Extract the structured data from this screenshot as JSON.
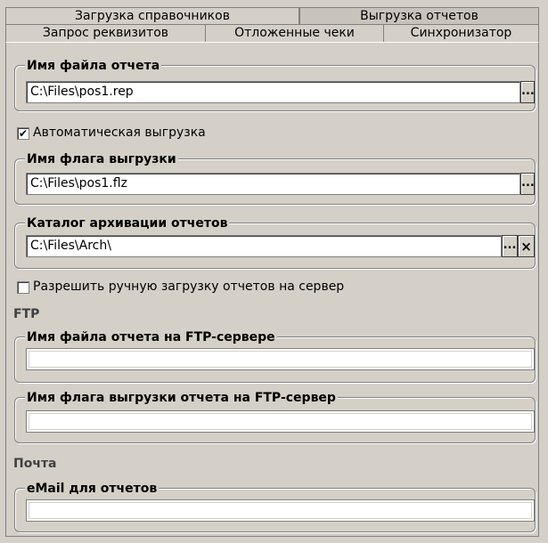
{
  "tabs_row1": [
    {
      "label": "Загрузка справочников",
      "active": true
    },
    {
      "label": "Выгрузка отчетов",
      "active": false
    }
  ],
  "tabs_row2": [
    {
      "label": "Запрос реквизитов"
    },
    {
      "label": "Отложенные чеки"
    },
    {
      "label": "Синхронизатор"
    }
  ],
  "report_file": {
    "title": "Имя файла отчета",
    "value": "C:\\Files\\pos1.rep",
    "browse": "..."
  },
  "auto_upload": {
    "label": "Автоматическая выгрузка",
    "checked": true,
    "mark": "✔"
  },
  "flag_file": {
    "title": "Имя флага выгрузки",
    "value": "C:\\Files\\pos1.flz",
    "browse": "..."
  },
  "archive_dir": {
    "title": "Каталог архивации отчетов",
    "value": "C:\\Files\\Arch\\",
    "browse": "...",
    "clear": "×"
  },
  "manual_upload": {
    "label": "Разрешить ручную загрузку отчетов на сервер",
    "checked": false
  },
  "ftp": {
    "heading": "FTP",
    "report_file": {
      "title": "Имя файла отчета на FTP-сервере",
      "value": ""
    },
    "flag_file": {
      "title": "Имя флага выгрузки отчета на FTP-сервер",
      "value": ""
    }
  },
  "mail": {
    "heading": "Почта",
    "email": {
      "title": "eMail для отчетов",
      "value": ""
    }
  }
}
